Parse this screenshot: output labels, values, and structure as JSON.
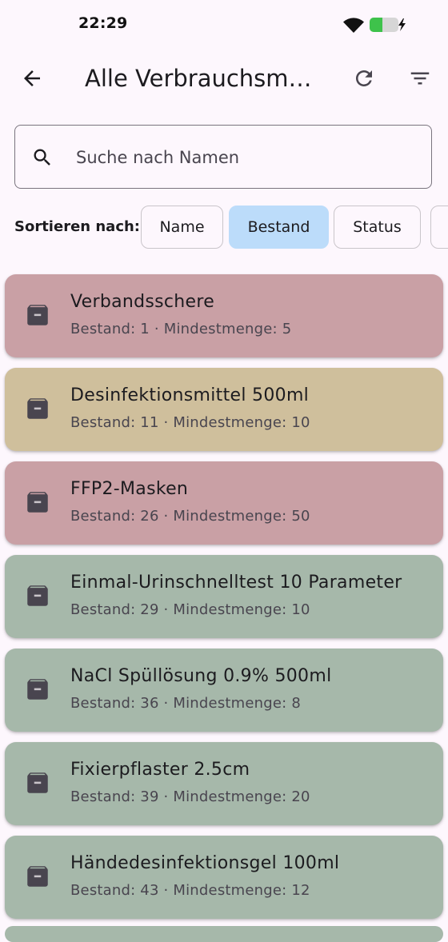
{
  "status_bar": {
    "time": "22:29"
  },
  "app_bar": {
    "title": "Alle Verbrauchsmaterialien",
    "icons": [
      "arrow-back-icon",
      "refresh-icon",
      "filter-list-icon"
    ]
  },
  "search": {
    "placeholder": "Suche nach Namen",
    "value": ""
  },
  "sort": {
    "label": "Sortieren nach:",
    "options": [
      "Name",
      "Bestand",
      "Status"
    ],
    "selected": "Bestand"
  },
  "colors": {
    "critical": "#c9a0a5",
    "warning": "#cfbf9c",
    "ok": "#a6b8aa",
    "chip_selected": "#bcdcfa",
    "background": "#fdf7fd"
  },
  "items": [
    {
      "name": "Verbandsschere",
      "subtitle": "Bestand: 1 · Mindestmenge: 5",
      "status": "critical"
    },
    {
      "name": "Desinfektionsmittel 500ml",
      "subtitle": "Bestand: 11 · Mindestmenge: 10",
      "status": "warning"
    },
    {
      "name": "FFP2-Masken",
      "subtitle": "Bestand: 26 · Mindestmenge: 50",
      "status": "critical"
    },
    {
      "name": "Einmal-Urinschnelltest 10 Parameter",
      "subtitle": "Bestand: 29 · Mindestmenge: 10",
      "status": "ok"
    },
    {
      "name": "NaCl Spüllösung 0.9% 500ml",
      "subtitle": "Bestand: 36 · Mindestmenge: 8",
      "status": "ok"
    },
    {
      "name": "Fixierpflaster 2.5cm",
      "subtitle": "Bestand: 39 · Mindestmenge: 20",
      "status": "ok"
    },
    {
      "name": "Händedesinfektionsgel 100ml",
      "subtitle": "Bestand: 43 · Mindestmenge: 12",
      "status": "ok"
    }
  ]
}
